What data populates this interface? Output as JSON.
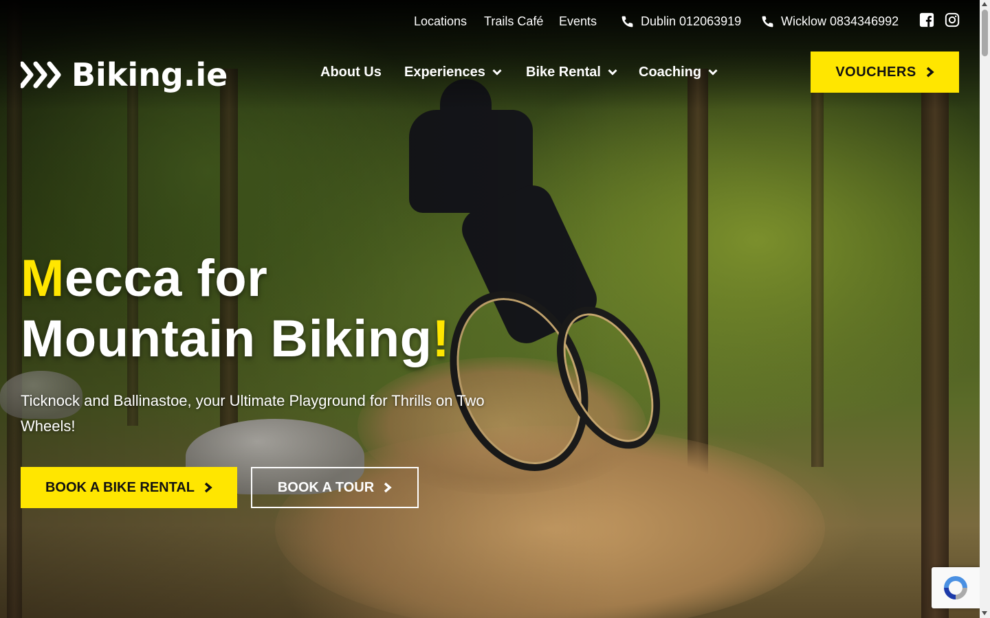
{
  "topbar": {
    "links": [
      "Locations",
      "Trails Café",
      "Events"
    ],
    "phones": [
      {
        "label": "Dublin 012063919",
        "icon": "phone-icon"
      },
      {
        "label": "Wicklow 0834346992",
        "icon": "phone-icon"
      }
    ],
    "social": [
      "facebook-icon",
      "instagram-icon"
    ]
  },
  "logo": {
    "text": "Biking.ie",
    "icon": "chevrons-logo-icon"
  },
  "nav": {
    "items": [
      {
        "label": "About Us",
        "dropdown": false
      },
      {
        "label": "Experiences",
        "dropdown": true
      },
      {
        "label": "Bike Rental",
        "dropdown": true
      },
      {
        "label": "Coaching",
        "dropdown": true
      }
    ],
    "cta": "VOUCHERS"
  },
  "hero": {
    "headline_line1_accent": "M",
    "headline_line1_rest": "ecca for",
    "headline_line2_main": "Mountain Biking",
    "headline_line2_accent": "!",
    "subtitle": "Ticknock and Ballinastoe, your Ultimate Playground for Thrills on Two Wheels!",
    "buttons": {
      "primary": "BOOK A BIKE RENTAL",
      "secondary": "BOOK A TOUR"
    }
  },
  "colors": {
    "accent": "#ffe600",
    "text": "#ffffff",
    "button_text": "#111111"
  }
}
